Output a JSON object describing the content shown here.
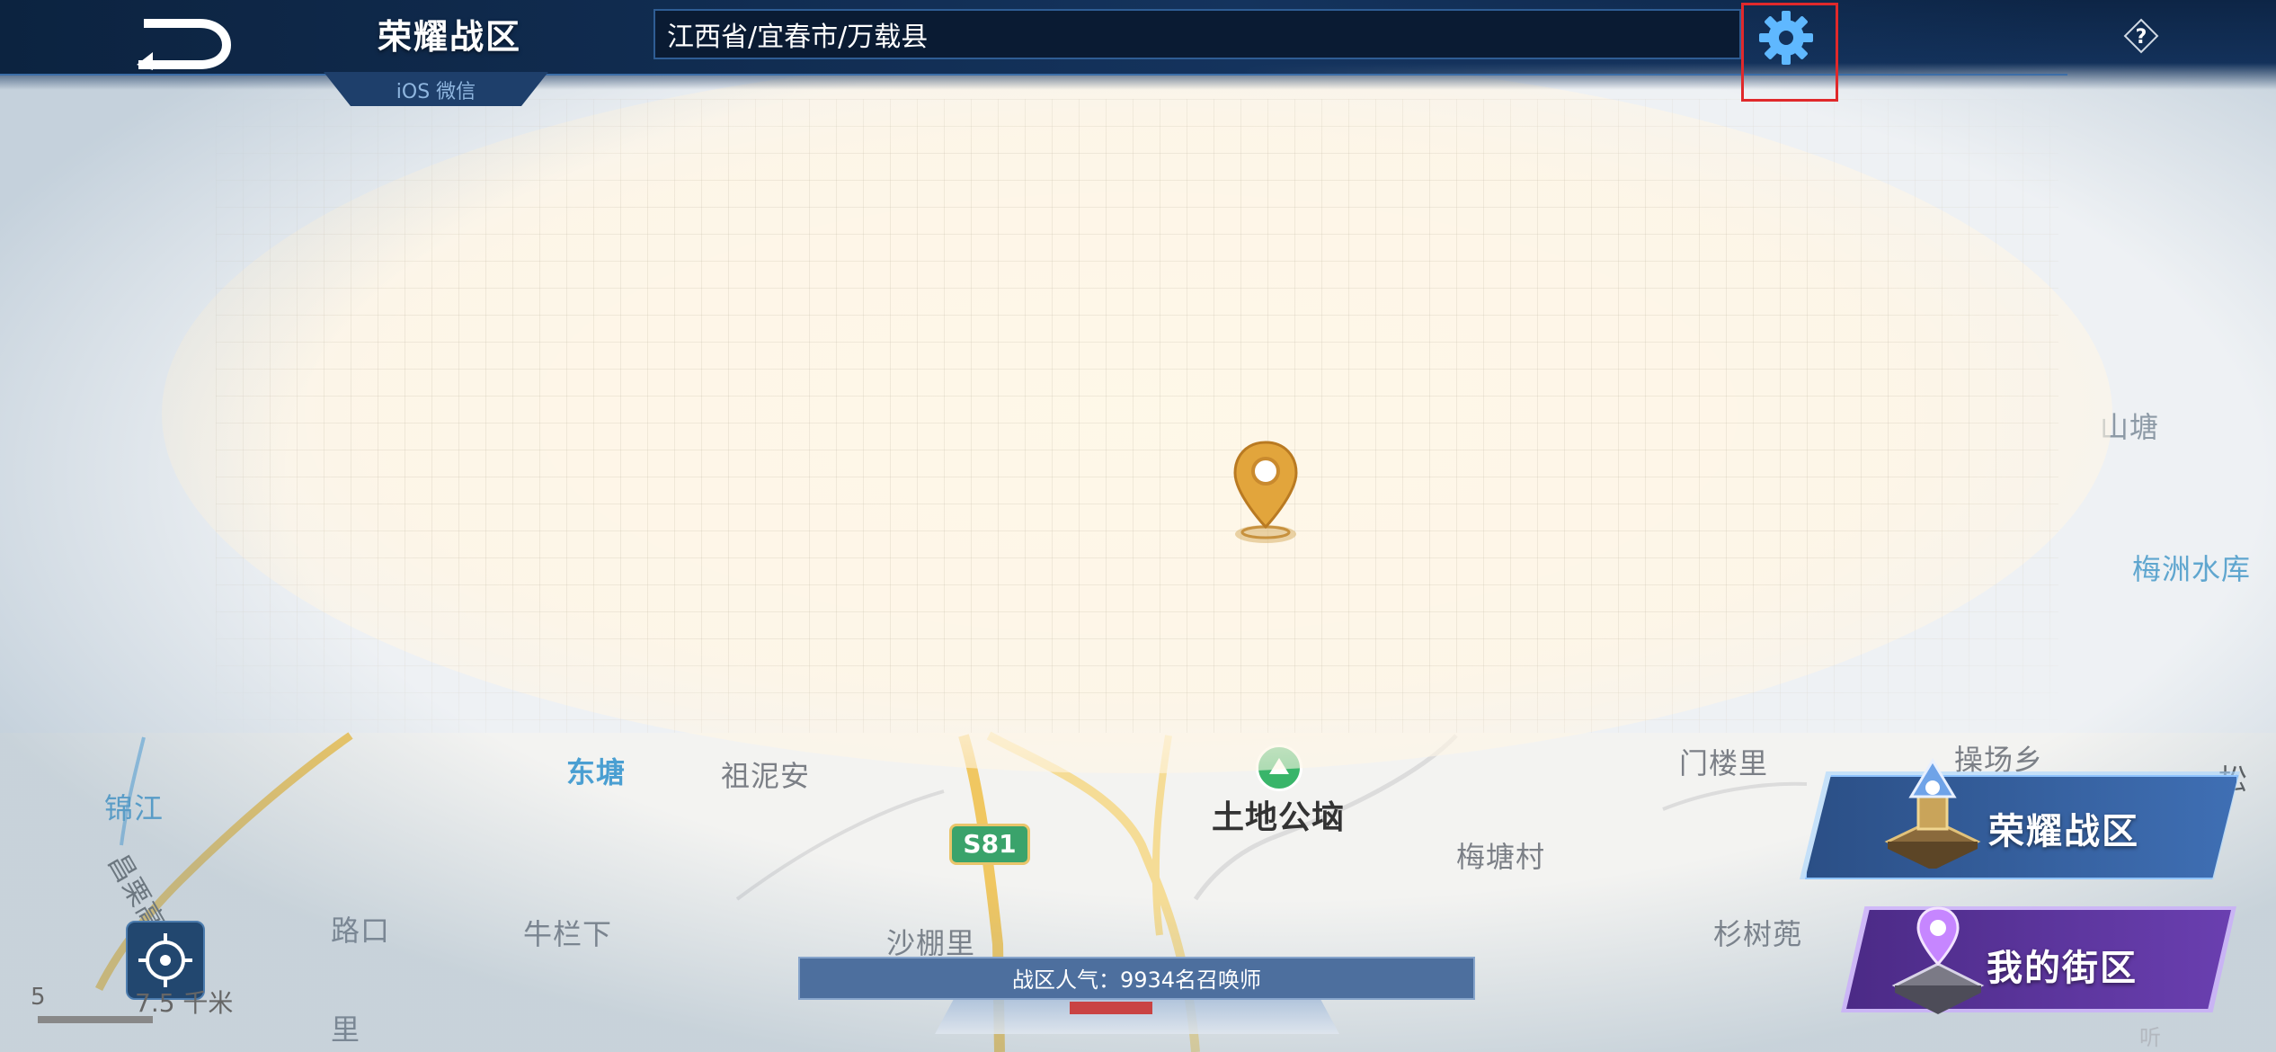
{
  "header": {
    "title": "荣耀战区",
    "subtitle": "iOS 微信",
    "location": "江西省/宜春市/万载县"
  },
  "map": {
    "labels": {
      "shantang": "山塘",
      "meizhou_reservoir": "梅洲水库",
      "caochang": "操场乡",
      "song": "松",
      "jinjiang": "锦江",
      "dongtang": "东塘",
      "zunian": "祖泥安",
      "tudi": "土地公垴",
      "menlouli": "门楼里",
      "meitang": "梅塘村",
      "lukou": "路口",
      "niulanxia": "牛栏下",
      "shapengli": "沙棚里",
      "shanshu": "杉树蔸",
      "li": "里",
      "expressway": "昌栗高速"
    },
    "road_badge": "S81",
    "scale_number": "5",
    "scale_label": "7.5 千米"
  },
  "popularity": {
    "text": "战区人气：9934名召唤师"
  },
  "buttons": {
    "zone": "荣耀战区",
    "street": "我的街区"
  },
  "misc": {
    "ting": "听"
  },
  "colors": {
    "topbar": "#13315a",
    "highlight": "#e0292b",
    "zone_button": "#3f6fb4",
    "street_button": "#6a3fb0",
    "map_blue_label": "#4a9fd2"
  }
}
